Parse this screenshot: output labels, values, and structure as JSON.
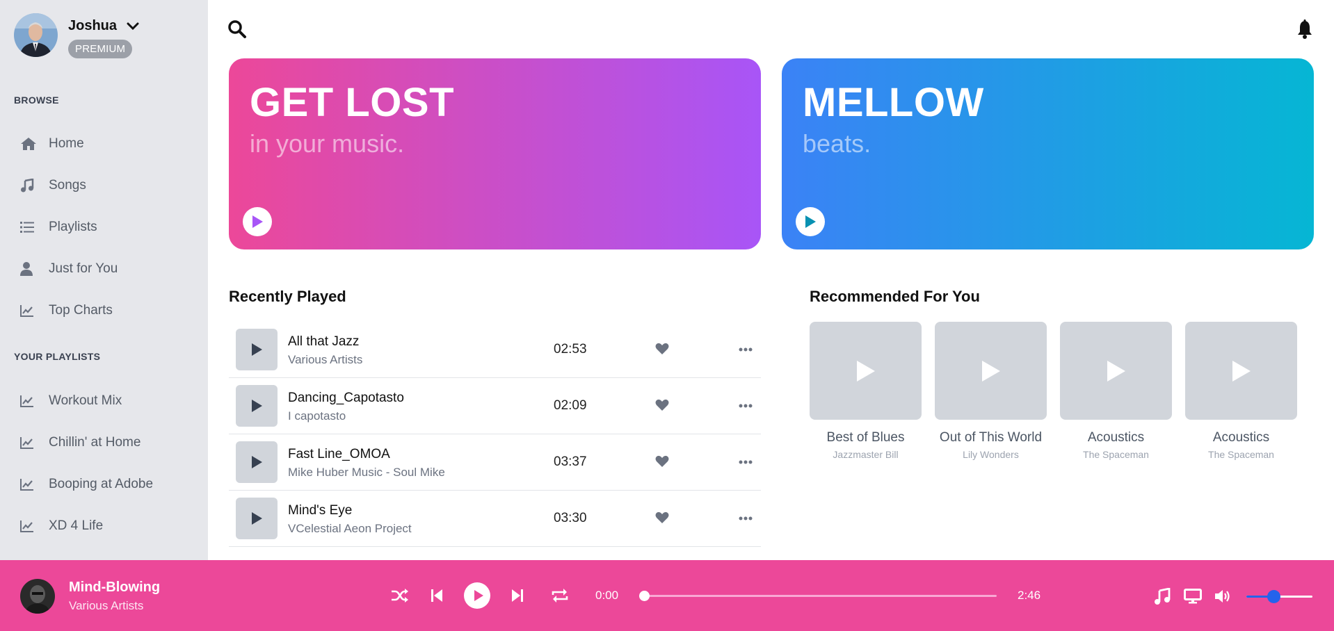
{
  "user": {
    "name": "Joshua",
    "badge": "PREMIUM"
  },
  "sidebar": {
    "browse_title": "BROWSE",
    "browse": [
      {
        "label": "Home",
        "icon": "home-icon"
      },
      {
        "label": "Songs",
        "icon": "music-note-icon"
      },
      {
        "label": "Playlists",
        "icon": "list-icon"
      },
      {
        "label": "Just for You",
        "icon": "user-icon"
      },
      {
        "label": "Top Charts",
        "icon": "chart-line-icon"
      }
    ],
    "playlists_title": "YOUR PLAYLISTS",
    "playlists": [
      {
        "label": "Workout Mix",
        "icon": "chart-line-icon"
      },
      {
        "label": "Chillin' at Home",
        "icon": "chart-line-icon"
      },
      {
        "label": "Booping at Adobe",
        "icon": "chart-line-icon"
      },
      {
        "label": "XD 4 Life",
        "icon": "chart-line-icon"
      }
    ]
  },
  "header": {
    "search_icon": "search-icon",
    "notification_icon": "bell-icon"
  },
  "heroes": [
    {
      "title": "GET LOST",
      "subtitle": "in your music.",
      "gradient": [
        "#ec4899",
        "#a855f7"
      ],
      "play_color": "#a855f7"
    },
    {
      "title": "MELLOW",
      "subtitle": "beats.",
      "gradient": [
        "#3b82f6",
        "#06b6d4"
      ],
      "play_color": "#0891b2"
    }
  ],
  "recently_played": {
    "title": "Recently Played",
    "tracks": [
      {
        "title": "All that Jazz",
        "artist": "Various Artists",
        "duration": "02:53"
      },
      {
        "title": "Dancing_Capotasto",
        "artist": "I capotasto",
        "duration": "02:09"
      },
      {
        "title": "Fast Line_OMOA",
        "artist": "Mike Huber Music - Soul Mike",
        "duration": "03:37"
      },
      {
        "title": "Mind's Eye",
        "artist": "VCelestial Aeon Project",
        "duration": "03:30"
      }
    ]
  },
  "recommended": {
    "title": "Recommended For You",
    "items": [
      {
        "title": "Best of Blues",
        "artist": "Jazzmaster Bill"
      },
      {
        "title": "Out of This World",
        "artist": "Lily Wonders"
      },
      {
        "title": "Acoustics",
        "artist": "The Spaceman"
      },
      {
        "title": "Acoustics",
        "artist": "The Spaceman"
      }
    ]
  },
  "player": {
    "title": "Mind-Blowing",
    "artist": "Various Artists",
    "current_time": "0:00",
    "total_time": "2:46",
    "progress": 0,
    "volume": 0.42,
    "accent": "#ec4899",
    "volume_color": "#2563eb"
  }
}
